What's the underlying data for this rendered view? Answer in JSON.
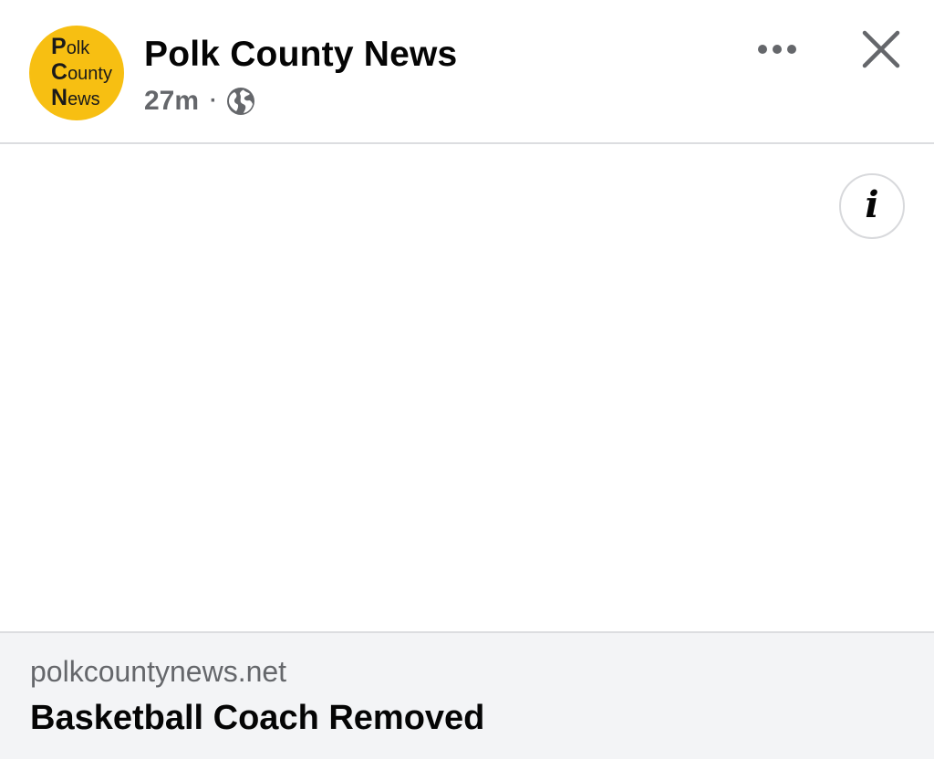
{
  "header": {
    "page_name": "Polk County News",
    "timestamp": "27m",
    "separator": "·",
    "audience_icon": "globe-icon",
    "more_icon": "more-dots-icon",
    "close_icon": "close-icon"
  },
  "avatar": {
    "line1_cap": "P",
    "line1_rest": "olk",
    "line2_cap": "C",
    "line2_rest": "ounty",
    "line3_cap": "N",
    "line3_rest": "ews",
    "bg_color": "#f7bf12"
  },
  "media": {
    "info_icon": "info-icon",
    "info_glyph": "i"
  },
  "link_preview": {
    "domain": "polkcountynews.net",
    "headline": "Basketball Coach Removed"
  },
  "colors": {
    "text_primary": "#050505",
    "text_secondary": "#65676b",
    "preview_bg": "#f3f4f6",
    "divider": "#dcdde0"
  }
}
